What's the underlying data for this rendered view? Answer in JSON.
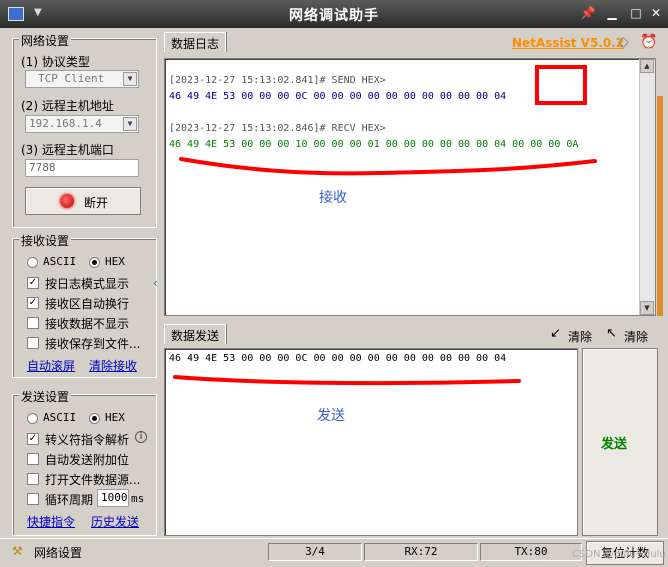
{
  "window": {
    "title": "网络调试助手"
  },
  "net": {
    "legend": "网络设置",
    "protocol_label": "(1) 协议类型",
    "protocol_value": "TCP Client",
    "host_label": "(2) 远程主机地址",
    "host_value": "192.168.1.4",
    "port_label": "(3) 远程主机端口",
    "port_value": "7788",
    "disconnect_label": "断开"
  },
  "recv_settings": {
    "legend": "接收设置",
    "ascii_label": "ASCII",
    "hex_label": "HEX",
    "selected": "HEX",
    "options": [
      {
        "label": "按日志模式显示",
        "checked": true
      },
      {
        "label": "接收区自动换行",
        "checked": true
      },
      {
        "label": "接收数据不显示",
        "checked": false
      },
      {
        "label": "接收保存到文件...",
        "checked": false
      }
    ],
    "auto_clear_link": "自动滚屏",
    "clear_link": "清除接收"
  },
  "send_settings": {
    "legend": "发送设置",
    "ascii_label": "ASCII",
    "hex_label": "HEX",
    "selected": "HEX",
    "options": [
      {
        "label": "转义符指令解析",
        "checked": true
      },
      {
        "label": "自动发送附加位",
        "checked": false
      },
      {
        "label": "打开文件数据源...",
        "checked": false
      }
    ],
    "cycle_label": "循环周期",
    "cycle_value": "1000",
    "cycle_unit": "ms",
    "shortcut_link": "快捷指令",
    "history_link": "历史发送"
  },
  "log": {
    "tab_label": "数据日志",
    "brand": "NetAssist V5.0.2",
    "entries": [
      {
        "header": "[2023-12-27 15:13:02.841]# SEND HEX>",
        "data": "46 49 4E 53 00 00 00 0C 00 00 00 00 00 00 00 00 00 00 04",
        "kind": "send"
      },
      {
        "header": "[2023-12-27 15:13:02.846]# RECV HEX>",
        "data": "46 49 4E 53 00 00 00 10 00 00 00 01 00 00 00 00 00 00 04 00 00 00 0A",
        "kind": "recv"
      }
    ],
    "annotation": "接收"
  },
  "send": {
    "tab_label": "数据发送",
    "clear_label_1": "清除",
    "clear_label_2": "清除",
    "content": "46 49 4E 53 00 00 00 0C 00 00 00 00 00 00 00 00 00 00 04",
    "annotation": "发送",
    "send_button": "发送"
  },
  "status": {
    "label": "网络设置",
    "count": "3/4",
    "rx": "RX:72",
    "tx": "TX:80",
    "reset": "复位计数",
    "watermark": "CSDN @dulu~dulu"
  },
  "colors": {
    "brand": "#ff8c00",
    "send_hex": "#00008b",
    "recv_hex": "#008000",
    "annotation_red": "#ff0000",
    "annotation_text": "#3a5fcd",
    "send_button_text": "#008000"
  }
}
